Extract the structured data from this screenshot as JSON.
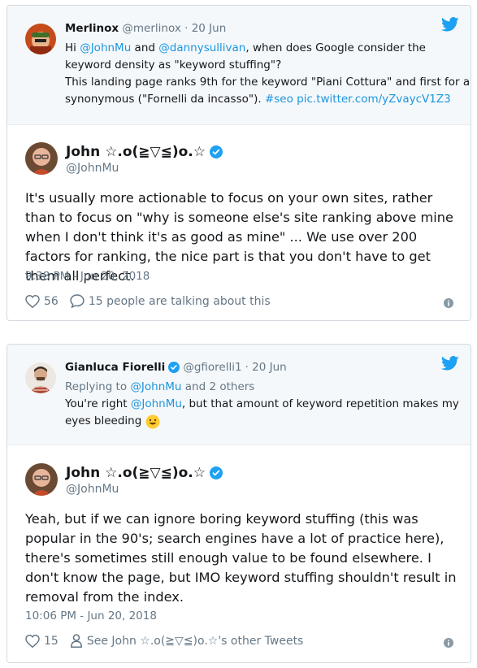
{
  "card1": {
    "parent": {
      "name": "Merlinox",
      "handle": "@merlinox",
      "date": "· 20 Jun",
      "text1_pre": "Hi ",
      "mention1": "@JohnMu",
      "text1_and": " and ",
      "mention2": "@dannysullivan",
      "text1_post": ", when does Google consider the",
      "line2": "keyword density as \"keyword stuffing\"?",
      "line3": "This landing page ranks 9th for the keyword \"Piani Cottura\" and first for a",
      "line4_pre": "synonymous (\"Fornelli da incasso\"). ",
      "hashtag": "#seo",
      "piclink": "pic.twitter.com/yZvaycV1Z3"
    },
    "main": {
      "name": "John ☆.o(≧▽≦)o.☆",
      "handle": "@JohnMu",
      "text": "It's usually more actionable to focus on your own sites, rather than to focus on \"why is someone else's site ranking above mine when I don't think it's as good as mine\" ... We use over 200 factors for ranking, the nice part is that you don't have to get them all perfect.",
      "time": "9:38 PM - Jun 20, 2018",
      "likes": "56",
      "talk": "15 people are talking about this"
    }
  },
  "card2": {
    "parent": {
      "name": "Gianluca Fiorelli",
      "handle": "@gfiorelli1",
      "date": "· 20 Jun",
      "reply_pre": "Replying to ",
      "reply_mention": "@JohnMu",
      "reply_post": " and 2 others",
      "text_pre": "You're right ",
      "mention": "@JohnMu",
      "text_post": ", but that amount of keyword repetition makes my",
      "line2": "eyes bleeding"
    },
    "main": {
      "name": "John ☆.o(≧▽≦)o.☆",
      "handle": "@JohnMu",
      "text": "Yeah, but if we can ignore boring keyword stuffing (this was popular in the 90's; search engines have a lot of practice here), there's sometimes still enough value to be found elsewhere. I don't know the page, but IMO keyword stuffing shouldn't result in removal from the index.",
      "time": "10:06 PM - Jun 20, 2018",
      "likes": "15",
      "other": "See John ☆.o(≧▽≦)o.☆'s other Tweets"
    }
  },
  "colors": {
    "link": "#1b95e0",
    "verified": "#1da1f2",
    "muted": "#657786"
  }
}
